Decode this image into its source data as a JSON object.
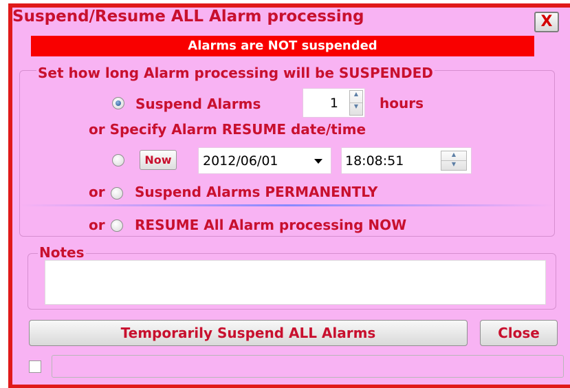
{
  "dialog": {
    "title": "Suspend/Resume ALL Alarm processing",
    "close_x_label": "X",
    "status_text": "Alarms are NOT suspended"
  },
  "suspend_group": {
    "legend": "Set how long Alarm processing will be SUSPENDED",
    "option_hours": {
      "label": "Suspend Alarms",
      "checked": true,
      "value": "1",
      "unit": "hours"
    },
    "resume_datetime_label": "or Specify Alarm RESUME date/time",
    "option_datetime": {
      "checked": false,
      "now_label": "Now",
      "date": "2012/06/01",
      "time": "18:08:51"
    },
    "option_permanent": {
      "prefix": "or",
      "label": "Suspend Alarms PERMANENTLY",
      "checked": false
    }
  },
  "resume_option": {
    "prefix": "or",
    "label": "RESUME All Alarm processing NOW",
    "checked": false
  },
  "notes": {
    "legend": "Notes",
    "value": ""
  },
  "actions": {
    "suspend_label": "Temporarily Suspend ALL Alarms",
    "close_label": "Close"
  },
  "colors": {
    "background": "#f8b3f3",
    "accent": "#c8102e",
    "status_bar": "#f90000",
    "border": "#e01a1a"
  }
}
